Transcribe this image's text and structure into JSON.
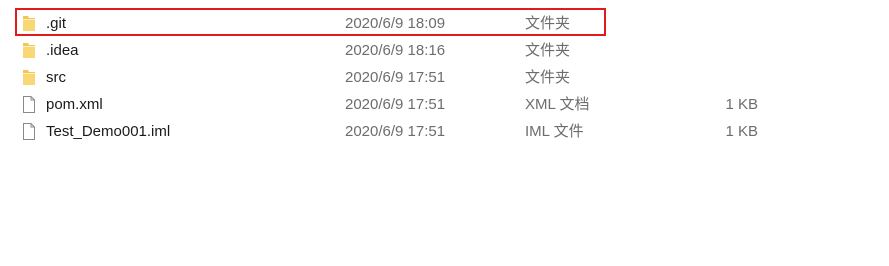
{
  "files": [
    {
      "name": ".git",
      "modified": "2020/6/9 18:09",
      "type": "文件夹",
      "size": "",
      "icon": "folder-icon"
    },
    {
      "name": ".idea",
      "modified": "2020/6/9 18:16",
      "type": "文件夹",
      "size": "",
      "icon": "folder-icon"
    },
    {
      "name": "src",
      "modified": "2020/6/9 17:51",
      "type": "文件夹",
      "size": "",
      "icon": "folder-icon"
    },
    {
      "name": "pom.xml",
      "modified": "2020/6/9 17:51",
      "type": "XML 文档",
      "size": "1 KB",
      "icon": "file-icon"
    },
    {
      "name": "Test_Demo001.iml",
      "modified": "2020/6/9 17:51",
      "type": "IML 文件",
      "size": "1 KB",
      "icon": "file-icon"
    }
  ],
  "colors": {
    "folder": "#f6c64f",
    "highlight": "#e11a1a"
  }
}
